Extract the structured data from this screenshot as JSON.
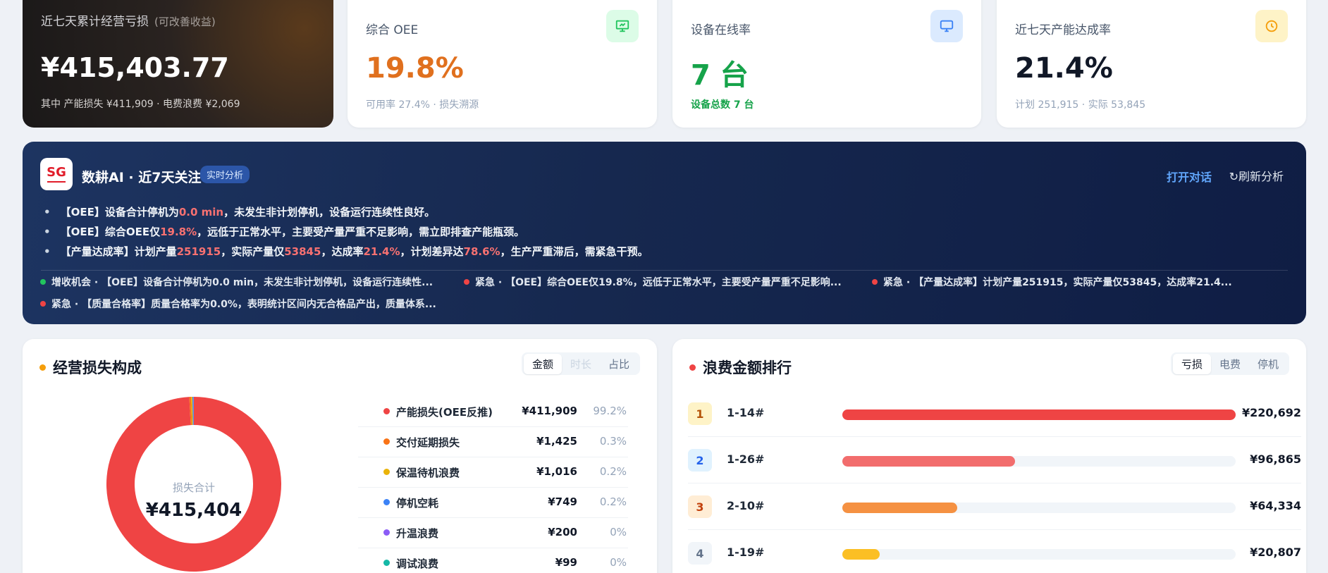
{
  "kpis": {
    "loss": {
      "title": "近七天累计经营亏损",
      "note": "(可改善收益)",
      "value": "¥415,403.77",
      "sub": "其中 产能损失 ¥411,909 · 电费浪费 ¥2,069"
    },
    "oee": {
      "title": "综合 OEE",
      "value": "19.8%",
      "sub": "可用率 27.4% · 损失溯源",
      "icon": "presentation-chart-icon",
      "color": "#e0701e"
    },
    "online": {
      "title": "设备在线率",
      "value": "7 台",
      "sub": "设备总数 7 台",
      "icon": "monitor-icon",
      "color": "#16a34a"
    },
    "capacity": {
      "title": "近七天产能达成率",
      "value": "21.4%",
      "sub": "计划 251,915 · 实际 53,845",
      "icon": "clock-icon",
      "color": "#111827"
    }
  },
  "ai": {
    "logo_text": "SG",
    "title": "数耕AI · 近7天关注",
    "badge": "实时分析",
    "open_chat": "打开对话",
    "refresh": "刷新分析",
    "bullets": [
      {
        "pre": "【OEE】设备合计停机为",
        "hl": "0.0 min",
        "post": "，未发生非计划停机，设备运行连续性良好。"
      },
      {
        "pre": "【OEE】综合OEE仅",
        "hl": "19.8%",
        "post": "，远低于正常水平，主要受产量严重不足影响，需立即排查产能瓶颈。"
      },
      {
        "pre": "【产量达成率】计划产量",
        "hl": "251915",
        "mid": "，实际产量仅",
        "hl2": "53845",
        "mid2": "，达成率",
        "hl3": "21.4%",
        "mid3": "，计划差异达",
        "hl4": "78.6%",
        "post": "，生产严重滞后，需紧急干预。"
      }
    ],
    "tags": [
      {
        "text": "增收机会 · 【OEE】设备合计停机为0.0 min，未发生非计划停机，设备运行连续性...",
        "color": "#22c55e"
      },
      {
        "text": "紧急 · 【OEE】综合OEE仅19.8%，远低于正常水平，主要受产量严重不足影响...",
        "color": "#ef4444"
      },
      {
        "text": "紧急 · 【产量达成率】计划产量251915，实际产量仅53845，达成率21.4...",
        "color": "#ef4444"
      },
      {
        "text": "紧急 · 【质量合格率】质量合格率为0.0%，表明统计区间内无合格品产出，质量体系...",
        "color": "#ef4444"
      }
    ]
  },
  "loss_panel": {
    "title": "经营损失构成",
    "tabs": [
      "金额",
      "时长",
      "占比"
    ],
    "center_label": "损失合计",
    "center_value": "¥415,404",
    "items": [
      {
        "name": "产能损失(OEE反推)",
        "amount": "¥411,909",
        "pct": "99.2%",
        "color": "#ef4444"
      },
      {
        "name": "交付延期损失",
        "amount": "¥1,425",
        "pct": "0.3%",
        "color": "#f97316"
      },
      {
        "name": "保温待机浪费",
        "amount": "¥1,016",
        "pct": "0.2%",
        "color": "#eab308"
      },
      {
        "name": "停机空耗",
        "amount": "¥749",
        "pct": "0.2%",
        "color": "#3b82f6"
      },
      {
        "name": "升温浪费",
        "amount": "¥200",
        "pct": "0%",
        "color": "#8b5cf6"
      },
      {
        "name": "调试浪费",
        "amount": "¥99",
        "pct": "0%",
        "color": "#14b8a6"
      }
    ]
  },
  "chart_data": {
    "type": "pie",
    "categories": [
      "产能损失(OEE反推)",
      "交付延期损失",
      "保温待机浪费",
      "停机空耗",
      "升温浪费",
      "调试浪费"
    ],
    "values": [
      411909,
      1425,
      1016,
      749,
      200,
      99
    ],
    "colors": [
      "#ef4444",
      "#f97316",
      "#eab308",
      "#3b82f6",
      "#8b5cf6",
      "#14b8a6"
    ]
  },
  "waste_panel": {
    "title": "浪费金额排行",
    "tabs": [
      "亏损",
      "电费",
      "停机"
    ],
    "rows": [
      {
        "rank": "1",
        "name": "1-14#",
        "value": "¥220,692",
        "amount": 220692,
        "color": "#ef4444",
        "badge_bg": "#fef3c7",
        "badge_fg": "#b45309"
      },
      {
        "rank": "2",
        "name": "1-26#",
        "value": "¥96,865",
        "amount": 96865,
        "color": "#f26d6d",
        "badge_bg": "#e0f2fe",
        "badge_fg": "#2563eb"
      },
      {
        "rank": "3",
        "name": "2-10#",
        "value": "¥64,334",
        "amount": 64334,
        "color": "#f59142",
        "badge_bg": "#ffedd5",
        "badge_fg": "#c2410c"
      },
      {
        "rank": "4",
        "name": "1-19#",
        "value": "¥20,807",
        "amount": 20807,
        "color": "#fbbf24",
        "badge_bg": "#f1f5f9",
        "badge_fg": "#64748b"
      }
    ]
  }
}
